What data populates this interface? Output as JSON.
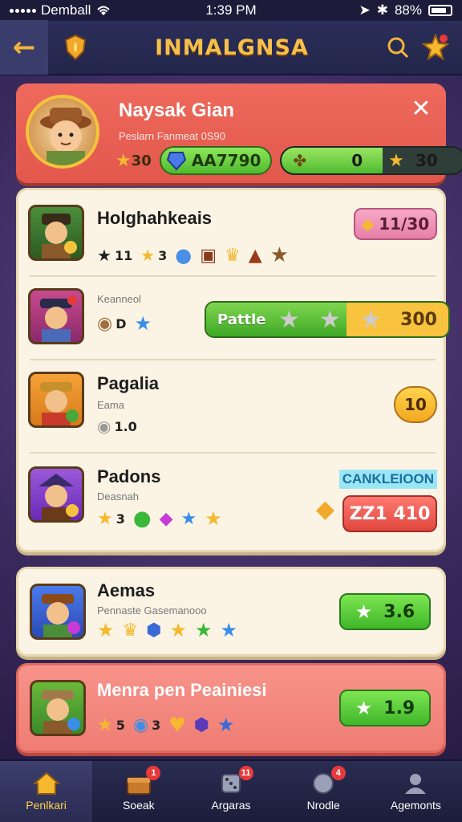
{
  "status_bar": {
    "carrier": "Demball",
    "time": "1:39 PM",
    "battery": "88%"
  },
  "header": {
    "title": "INMALGNSA"
  },
  "profile": {
    "name": "Naysak Gian",
    "subtitle": "Peslarn Fanmeat 0S90",
    "star_count": "30",
    "gems": "AA7790",
    "progress_value": "0",
    "progress_fraction": 0.55,
    "star_total": "30"
  },
  "rows": [
    {
      "title": "Holghahkeais",
      "stat1": "11",
      "stat2": "3",
      "badge": "11/30",
      "badge_color": "#e680a8"
    },
    {
      "subtitle": "Keanneol",
      "stat1": "D",
      "bar_label": "Pattle",
      "bar_fraction": 0.58,
      "bar_value": "300"
    },
    {
      "title": "Pagalia",
      "subtitle": "Eama",
      "stat1": "1.0",
      "coin": "10"
    },
    {
      "title": "Padons",
      "subtitle": "Deasnah",
      "stat1": "3",
      "tag": "CANKLEIOON",
      "red_value": "ZZ1 410"
    }
  ],
  "cards": [
    {
      "title": "Aemas",
      "subtitle": "Pennaste Gasemanooo",
      "button_value": "3.6"
    },
    {
      "title": "Menra pen Peainiesi",
      "stat1": "5",
      "stat2": "3",
      "button_value": "1.9"
    }
  ],
  "nav": [
    {
      "label": "Penlkari",
      "active": true
    },
    {
      "label": "Soeak",
      "badge": "1"
    },
    {
      "label": "Argaras",
      "badge": "11"
    },
    {
      "label": "Nrodle",
      "badge": "4"
    },
    {
      "label": "Agemonts"
    }
  ],
  "colors": {
    "accent": "#f5c04a",
    "card_red": "#e2574c",
    "green": "#4ebb2e",
    "cream": "#fbf4e4"
  }
}
